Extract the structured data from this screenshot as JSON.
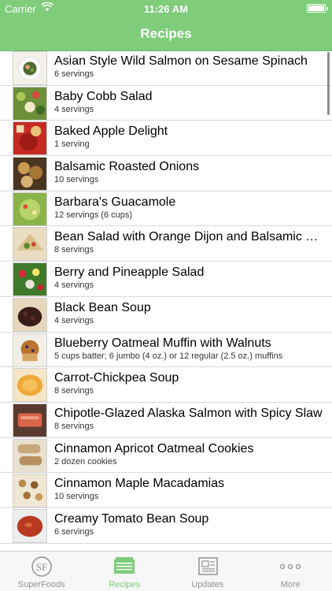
{
  "status_bar": {
    "carrier": "Carrier",
    "time": "11:26 AM"
  },
  "nav": {
    "title": "Recipes"
  },
  "recipes": [
    {
      "name": "Asian Style Wild Salmon on Sesame Spinach",
      "servings": "6 servings",
      "thumb": "salad-plate-icon"
    },
    {
      "name": "Baby Cobb Salad",
      "servings": "4 servings",
      "thumb": "salad-icon"
    },
    {
      "name": "Baked Apple Delight",
      "servings": "1 serving",
      "thumb": "apple-icon"
    },
    {
      "name": "Balsamic Roasted Onions",
      "servings": "10 servings",
      "thumb": "onion-icon"
    },
    {
      "name": "Barbara's Guacamole",
      "servings": "12 servings (6 cups)",
      "thumb": "guacamole-icon"
    },
    {
      "name": "Bean Salad with Orange Dijon and Balsamic Vinaigrette",
      "servings": "8 servings",
      "thumb": "wrap-icon"
    },
    {
      "name": "Berry and Pineapple Salad",
      "servings": "4 servings",
      "thumb": "berry-salad-icon"
    },
    {
      "name": "Black Bean Soup",
      "servings": "4 servings",
      "thumb": "bean-bowl-icon"
    },
    {
      "name": "Blueberry Oatmeal Muffin with Walnuts",
      "servings": "5 cups batter; 6 jumbo (4 oz.) or 12 regular (2.5 oz.) muffins",
      "thumb": "muffin-icon"
    },
    {
      "name": "Carrot-Chickpea Soup",
      "servings": "8 servings",
      "thumb": "soup-icon"
    },
    {
      "name": "Chipotle-Glazed Alaska Salmon with Spicy Slaw",
      "servings": "8 servings",
      "thumb": "salmon-icon"
    },
    {
      "name": "Cinnamon Apricot Oatmeal Cookies",
      "servings": "2 dozen cookies",
      "thumb": "cookie-icon"
    },
    {
      "name": "Cinnamon Maple Macadamias",
      "servings": "10 servings",
      "thumb": "nuts-icon"
    },
    {
      "name": "Creamy Tomato Bean Soup",
      "servings": "6 servings",
      "thumb": "tomato-soup-icon"
    }
  ],
  "tabs": [
    {
      "label": "SuperFoods",
      "icon": "superfoods-logo-icon",
      "active": false
    },
    {
      "label": "Recipes",
      "icon": "recipe-cards-icon",
      "active": true
    },
    {
      "label": "Updates",
      "icon": "newspaper-icon",
      "active": false
    },
    {
      "label": "More",
      "icon": "more-dots-icon",
      "active": false
    }
  ],
  "colors": {
    "accent": "#7fcc7b",
    "tab_inactive": "#929292"
  }
}
